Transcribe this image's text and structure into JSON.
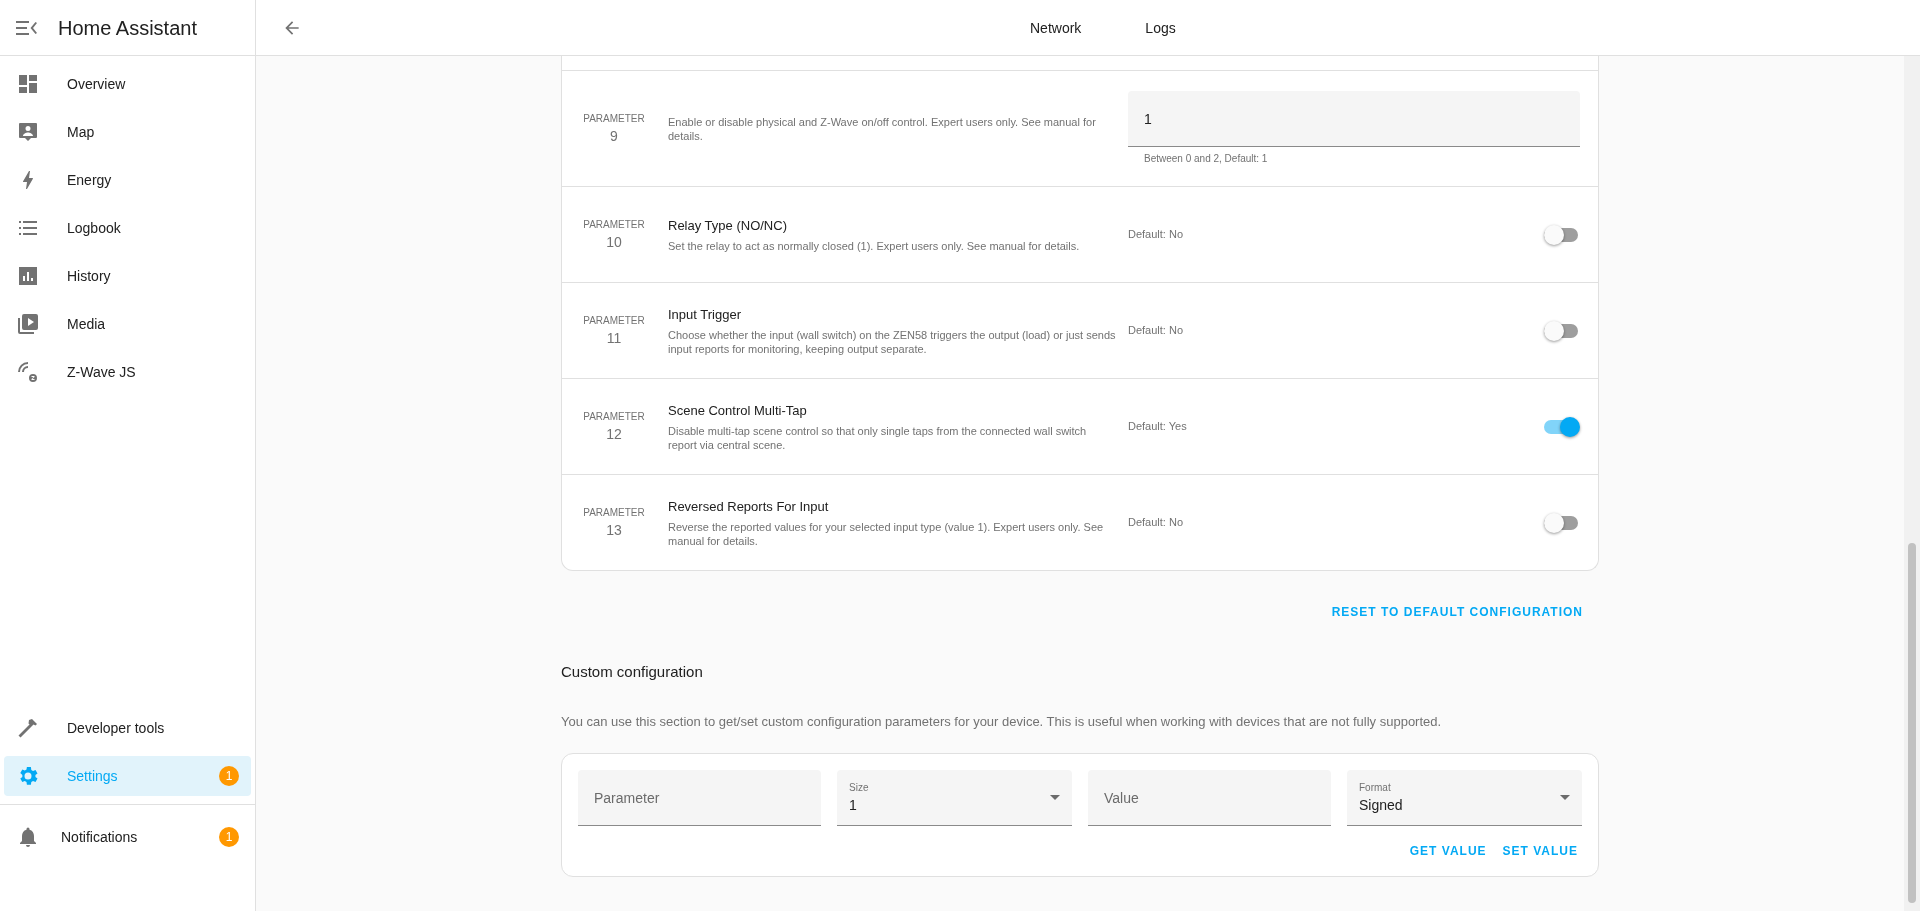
{
  "sidebar": {
    "title": "Home Assistant",
    "items": [
      {
        "label": "Overview",
        "selected": false
      },
      {
        "label": "Map",
        "selected": false
      },
      {
        "label": "Energy",
        "selected": false
      },
      {
        "label": "Logbook",
        "selected": false
      },
      {
        "label": "History",
        "selected": false
      },
      {
        "label": "Media",
        "selected": false
      },
      {
        "label": "Z-Wave JS",
        "selected": false
      }
    ],
    "bottom_items": [
      {
        "label": "Developer tools",
        "selected": false
      },
      {
        "label": "Settings",
        "selected": true,
        "badge": "1"
      }
    ],
    "notifications": {
      "label": "Notifications",
      "badge": "1"
    }
  },
  "header": {
    "tabs": [
      {
        "label": "Network",
        "selected": false
      },
      {
        "label": "Logs",
        "selected": false
      }
    ]
  },
  "parameters": [
    {
      "caption": "PARAMETER",
      "number": "9",
      "kind": "number",
      "description": "Enable or disable physical and Z-Wave on/off control. Expert users only. See manual for details.",
      "value": "1",
      "helper": "Between 0 and 2, Default: 1"
    },
    {
      "caption": "PARAMETER",
      "number": "10",
      "kind": "toggle",
      "title": "Relay Type (NO/NC)",
      "description": "Set the relay to act as normally closed (1). Expert users only. See manual for details.",
      "default": "Default: No",
      "on": false
    },
    {
      "caption": "PARAMETER",
      "number": "11",
      "kind": "toggle",
      "title": "Input Trigger",
      "description": "Choose whether the input (wall switch) on the ZEN58 triggers the output (load) or just sends input reports for monitoring, keeping output separate.",
      "default": "Default: No",
      "on": false
    },
    {
      "caption": "PARAMETER",
      "number": "12",
      "kind": "toggle",
      "title": "Scene Control Multi-Tap",
      "description": "Disable multi-tap scene control so that only single taps from the connected wall switch report via central scene.",
      "default": "Default: Yes",
      "on": true
    },
    {
      "caption": "PARAMETER",
      "number": "13",
      "kind": "toggle",
      "title": "Reversed Reports For Input",
      "description": "Reverse the reported values for your selected input type (value 1). Expert users only. See manual for details.",
      "default": "Default: No",
      "on": false
    }
  ],
  "reset_button": "RESET TO DEFAULT CONFIGURATION",
  "custom": {
    "title": "Custom configuration",
    "description": "You can use this section to get/set custom configuration parameters for your device. This is useful when working with devices that are not fully supported.",
    "fields": [
      {
        "kind": "text",
        "placeholder": "Parameter"
      },
      {
        "kind": "select",
        "label": "Size",
        "value": "1"
      },
      {
        "kind": "text",
        "placeholder": "Value"
      },
      {
        "kind": "select",
        "label": "Format",
        "value": "Signed"
      }
    ],
    "buttons": [
      "GET VALUE",
      "SET VALUE"
    ]
  }
}
